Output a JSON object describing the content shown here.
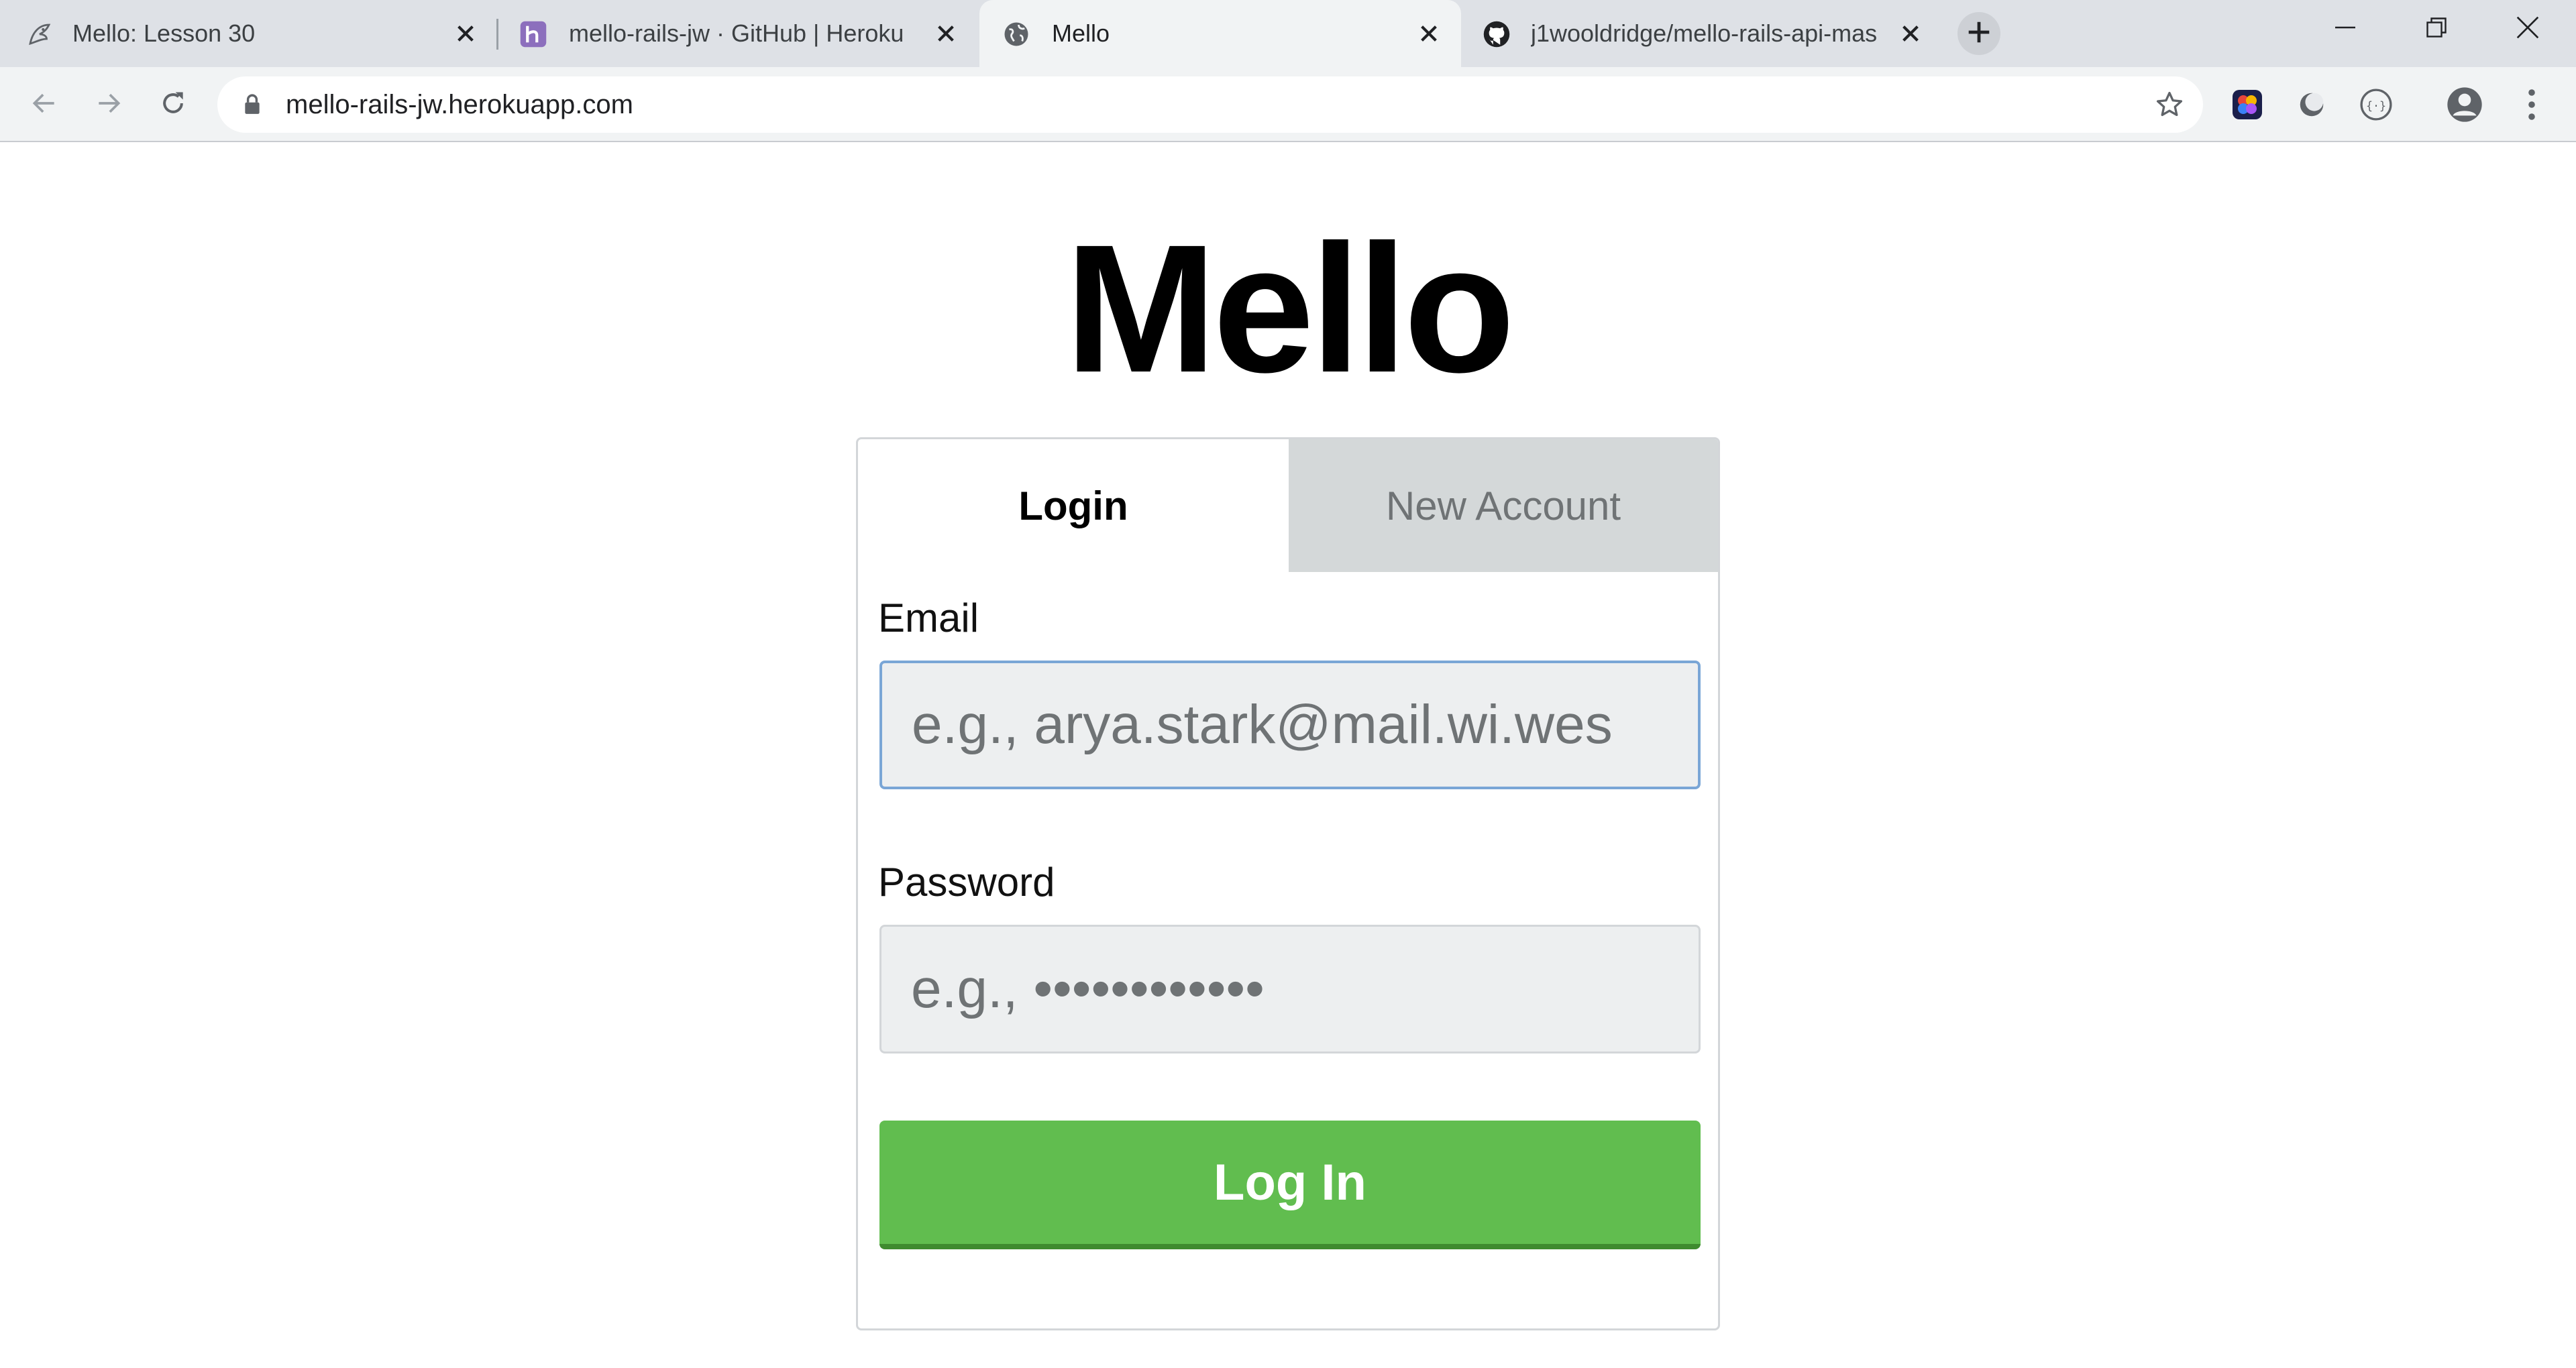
{
  "browser": {
    "tabs": [
      {
        "title": "Mello: Lesson 30",
        "icon": "lesson-icon",
        "active": false
      },
      {
        "title": "mello-rails-jw · GitHub | Heroku",
        "icon": "heroku-icon",
        "active": false
      },
      {
        "title": "Mello",
        "icon": "globe-icon",
        "active": true
      },
      {
        "title": "j1wooldridge/mello-rails-api-mas",
        "icon": "github-icon",
        "active": false
      }
    ],
    "url": "mello-rails-jw.herokuapp.com",
    "accent_color": "#1a73e8"
  },
  "page": {
    "title": "Mello",
    "auth_tabs": {
      "login": "Login",
      "new_account": "New Account"
    },
    "email": {
      "label": "Email",
      "placeholder": "e.g., arya.stark@mail.wi.wes",
      "value": ""
    },
    "password": {
      "label": "Password",
      "placeholder": "e.g., ••••••••••••",
      "value": ""
    },
    "submit_label": "Log In",
    "colors": {
      "primary_button": "#61bd4f",
      "inactive_tab": "#d4d8d9",
      "input_background": "#edeff0"
    }
  }
}
